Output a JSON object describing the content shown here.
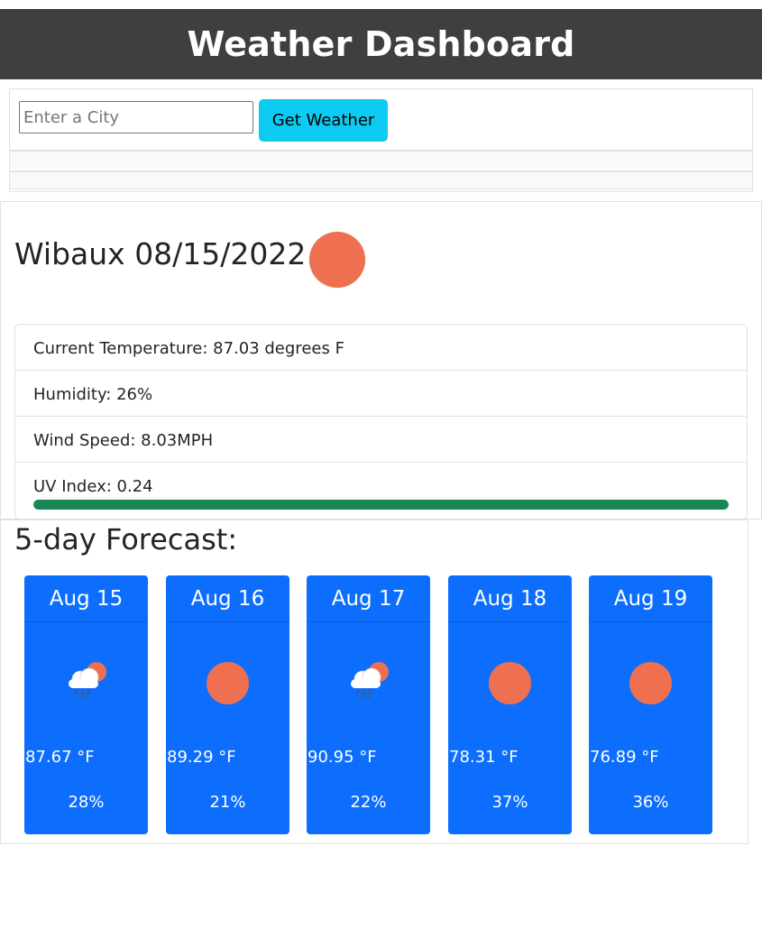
{
  "header": {
    "title": "Weather Dashboard"
  },
  "search": {
    "placeholder": "Enter a City",
    "value": "",
    "button_label": "Get Weather"
  },
  "current": {
    "city": "Wibaux",
    "date": "08/15/2022",
    "icon": "sun-icon",
    "temperature": "Current Temperature: 87.03 degrees F",
    "humidity": "Humidity: 26%",
    "wind": "Wind Speed: 8.03MPH",
    "uv_label": "UV Index: 0.24",
    "uv_bar_level_percent": 100,
    "uv_bar_color": "#198754"
  },
  "forecast": {
    "title": "5-day Forecast:",
    "days": [
      {
        "date": "Aug 15",
        "icon": "cloud-rain-sun-icon",
        "temp": "87.67 °F",
        "humidity": "28%"
      },
      {
        "date": "Aug 16",
        "icon": "sun-icon",
        "temp": "89.29 °F",
        "humidity": "21%"
      },
      {
        "date": "Aug 17",
        "icon": "cloud-rain-sun-icon",
        "temp": "90.95 °F",
        "humidity": "22%"
      },
      {
        "date": "Aug 18",
        "icon": "sun-icon",
        "temp": "78.31 °F",
        "humidity": "37%"
      },
      {
        "date": "Aug 19",
        "icon": "sun-icon",
        "temp": "76.89 °F",
        "humidity": "36%"
      }
    ]
  },
  "colors": {
    "header_bg": "#3f3f3f",
    "button_bg": "#0dcaf0",
    "card_bg": "#0d6efd",
    "sun": "#ef7050"
  }
}
